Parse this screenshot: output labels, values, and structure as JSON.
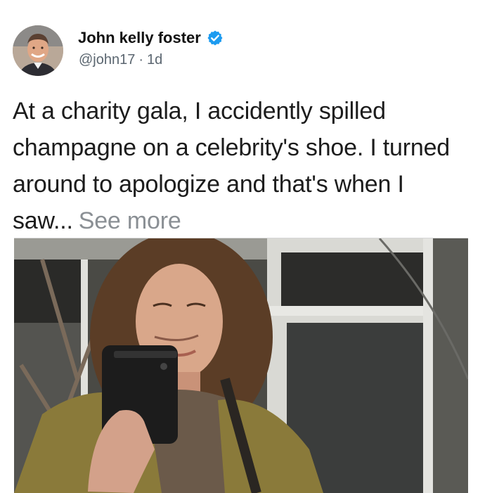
{
  "post": {
    "author": {
      "name": "John kelly foster",
      "verified": true,
      "handle": "@john17",
      "separator": "·",
      "time": "1d",
      "avatar_icon": "profile-photo"
    },
    "text": "At a charity gala, I accidently spilled champagne on a celebrity's shoe. I turned around to apologize and that's when I saw...",
    "see_more_label": "See more",
    "media": {
      "kind": "photo",
      "icon": "mirror-selfie-photo"
    }
  },
  "colors": {
    "verified_badge": "#1d9bf0",
    "text": "#1c1c1c",
    "muted": "#5b6670",
    "see_more": "#8a8f94"
  }
}
